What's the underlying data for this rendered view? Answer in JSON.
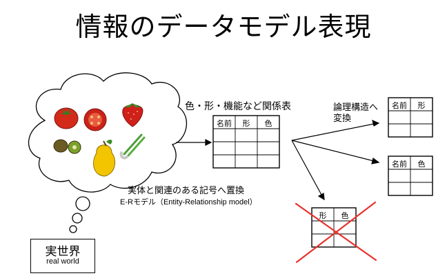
{
  "title": "情報のデータモデル表現",
  "main_table": {
    "caption": "色・形・機能など関係表",
    "headers": [
      "名前",
      "形",
      "色"
    ]
  },
  "transform_label": [
    "論理構造へ",
    "変換"
  ],
  "right_table_1": {
    "headers": [
      "名前",
      "形"
    ]
  },
  "right_table_2": {
    "headers": [
      "名前",
      "色"
    ]
  },
  "rejected_table": {
    "headers": [
      "形",
      "色"
    ]
  },
  "er_label": {
    "line1": "実体と関連のある記号へ置換",
    "line2": "E-Rモデル（Entity-Relationship model）"
  },
  "real_world": {
    "main": "実世界",
    "sub": "real world"
  },
  "colors": {
    "cross": "#e8302a",
    "tomato": "#d42a1a",
    "lemon": "#f2c500",
    "kiwi": "#6b5a22",
    "onion": "#4f9e3a"
  }
}
